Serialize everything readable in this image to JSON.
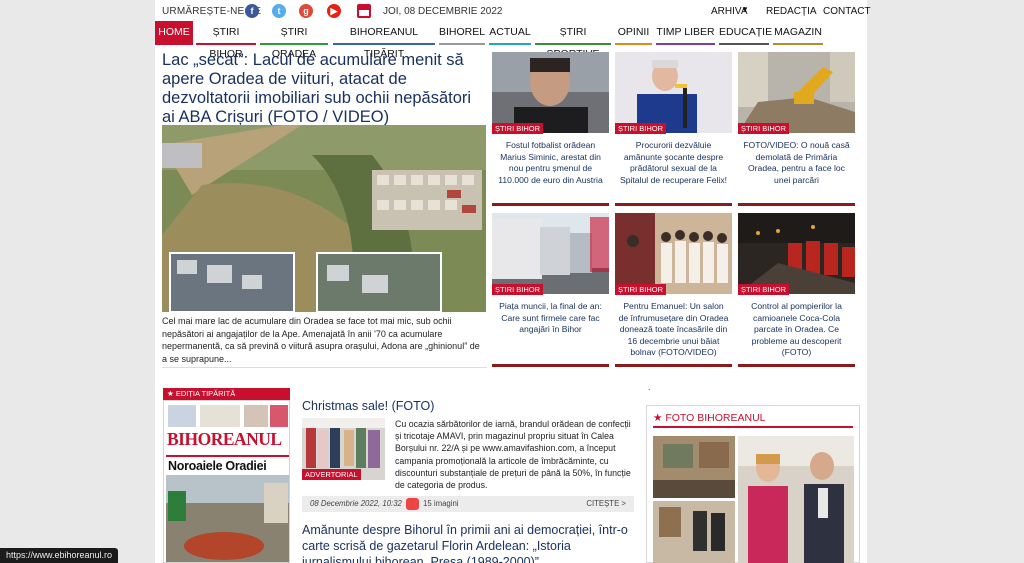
{
  "topbar": {
    "follow_label": "URMĂREȘTE-NE PE",
    "social": [
      {
        "icon": "facebook-icon",
        "glyph": "f"
      },
      {
        "icon": "twitter-icon",
        "glyph": "t"
      },
      {
        "icon": "google-plus-icon",
        "glyph": "g"
      },
      {
        "icon": "youtube-icon",
        "glyph": "▶"
      }
    ],
    "date": "JOI, 08 DECEMBRIE 2022",
    "links": {
      "arhiva": "ARHIVA",
      "redactia": "REDACȚIA",
      "contact": "CONTACT"
    }
  },
  "nav": {
    "items": [
      {
        "label": "HOME",
        "color": "#c8102e"
      },
      {
        "label": "ȘTIRI BIHOR",
        "color": "#c8102e"
      },
      {
        "label": "ȘTIRI ORADEA",
        "color": "#2e9a3c"
      },
      {
        "label": "BIHOREANUL TIPĂRIT",
        "color": "#3565a8"
      },
      {
        "label": "BIHOREL",
        "color": "#999999"
      },
      {
        "label": "ACTUAL",
        "color": "#23a3c8"
      },
      {
        "label": "ȘTIRI SPORTIVE",
        "color": "#3a8f3a"
      },
      {
        "label": "OPINII",
        "color": "#e08a1e"
      },
      {
        "label": "TIMP LIBER",
        "color": "#7a3fa1"
      },
      {
        "label": "EDUCAȚIE",
        "color": "#555555"
      },
      {
        "label": "MAGAZIN",
        "color": "#b88d2e"
      }
    ]
  },
  "hero": {
    "title": "Lac „secat”: Lacul de acumulare menit să apere Oradea de viituri, atacat de dezvoltatorii imobiliari sub ochii nepăsători ai ABA Crișuri (FOTO / VIDEO)",
    "excerpt": "Cel mai mare lac de acumulare din Oradea se face tot mai mic, sub ochii nepăsători ai angajaților de la Ape. Amenajată în anii '70 ca acumulare nepermanentă, ca să prevină o viitură asupra orașului, Adona are „ghinionul” de a se suprapune..."
  },
  "grid": [
    {
      "tag": "ȘTIRI BIHOR",
      "title": "Fostul fotbalist orădean Marius Siminic, arestat din nou pentru șmenul de 110.000 de euro din Austria"
    },
    {
      "tag": "ȘTIRI BIHOR",
      "title": "Procurorii dezvăluie amănunte șocante despre prădătorul sexual de la Spitalul de recuperare Felix!"
    },
    {
      "tag": "ȘTIRI BIHOR",
      "title": "FOTO/VIDEO: O nouă casă demolată de Primăria Oradea, pentru a face loc unei parcări"
    },
    {
      "tag": "ȘTIRI BIHOR",
      "title": "Piața muncii, la final de an: Care sunt firmele care fac angajări în Bihor"
    },
    {
      "tag": "ȘTIRI BIHOR",
      "title": "Pentru Emanuel: Un salon de înfrumusețare din Oradea donează toate încasările din 16 decembrie unui băiat bolnav (FOTO/VIDEO)"
    },
    {
      "tag": "ȘTIRI BIHOR",
      "title": "Control al pompierilor la camioanele Coca-Cola parcate în Oradea. Ce probleme au descoperit (FOTO)"
    }
  ],
  "dot": ".",
  "edition": {
    "label": "EDIȚIA TIPĂRITĂ",
    "masthead": "BIHOREANUL",
    "headline": "Noroaiele Oradiei"
  },
  "articles": [
    {
      "title": "Christmas sale! (FOTO)",
      "tag": "ADVERTORIAL",
      "text": "Cu ocazia sărbătorilor de iarnă, brandul orădean de confecții și tricotaje AMAVI, prin magazinul propriu situat în Calea Borșului nr. 22/A și pe www.amavifashion.com, a început campania promoțională la articole de îmbrăcăminte, cu discounturi substanțiale de prețuri de până la 50%, în funcție de categoria de produs.",
      "date": "08 Decembrie 2022, 10:32",
      "images": "15 imagini",
      "more": "CITEȘTE >"
    },
    {
      "title": "Amănunte despre Bihorul în primii ani ai democrației, într-o carte scrisă de gazetarul Florin Ardelean: „Istoria jurnalismului bihorean. Presa (1989-2000)”"
    }
  ],
  "foto": {
    "label": "FOTO BIHOREANUL"
  },
  "status_url": "https://www.ebihoreanul.ro"
}
